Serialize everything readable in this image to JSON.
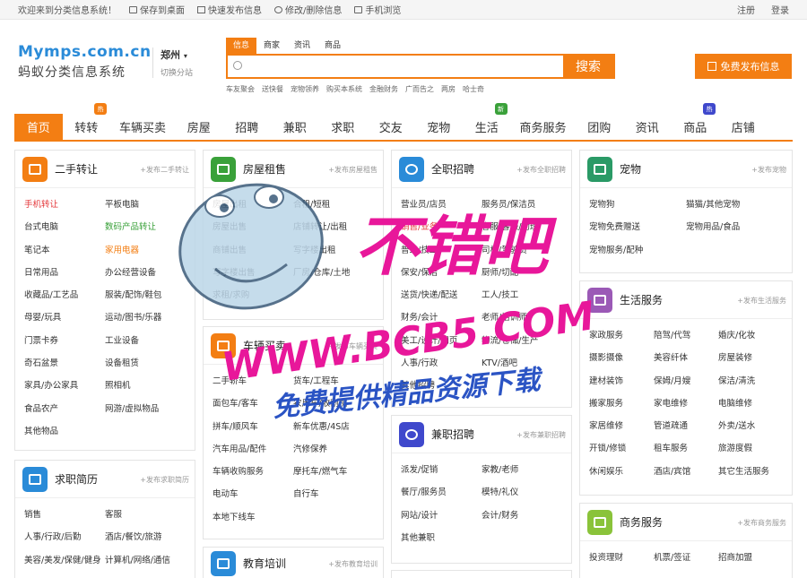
{
  "topbar": {
    "welcome": "欢迎来到分类信息系统！",
    "save_desktop": "保存到桌面",
    "quick_post": "快速发布信息",
    "edit_delete": "修改/删除信息",
    "mobile": "手机浏览",
    "register": "注册",
    "login": "登录"
  },
  "logo": {
    "en": "Mymps.com.cn",
    "cn": "蚂蚁分类信息系统"
  },
  "city": {
    "name": "郑州",
    "switch": "切换分站"
  },
  "search": {
    "tabs": [
      "信息",
      "商家",
      "资讯",
      "商品"
    ],
    "button": "搜索",
    "hot": [
      "车友聚会",
      "送快餐",
      "宠物领养",
      "购买本系统",
      "金融财务",
      "广而告之",
      "两房",
      "哈士奇"
    ]
  },
  "post_button": "免费发布信息",
  "nav": {
    "items": [
      "首页",
      "转转",
      "车辆买卖",
      "房屋",
      "招聘",
      "兼职",
      "求职",
      "交友",
      "宠物",
      "生活",
      "商务服务",
      "团购",
      "资讯",
      "商品",
      "店铺"
    ],
    "badges": {
      "zhuanzhuan": "热",
      "shenghuo": "新",
      "shangpin": "热"
    },
    "colors": {
      "accent": "#f37e13",
      "badge_orange": "#f37e13",
      "badge_green": "#3aa13a",
      "badge_blue": "#3f48cc"
    }
  },
  "panels": {
    "ershou": {
      "title": "二手转让",
      "add": "+发布二手转让",
      "icon": "cart-icon",
      "color": "#f37e13",
      "items": [
        "手机转让",
        "平板电脑",
        "台式电脑",
        "数码产品转让",
        "笔记本",
        "家用电器",
        "日常用品",
        "办公经营设备",
        "收藏品/工艺品",
        "服装/配饰/鞋包",
        "母婴/玩具",
        "运动/图书/乐器",
        "门票卡券",
        "工业设备",
        "奇石盆景",
        "设备租赁",
        "家具/办公家具",
        "照相机",
        "食品农产",
        "网游/虚拟物品",
        "其他物品"
      ]
    },
    "qiuzhi": {
      "title": "求职简历",
      "add": "+发布求职简历",
      "icon": "resume-icon",
      "color": "#2a8bd8",
      "items": [
        "销售",
        "客服",
        "人事/行政/后勤",
        "酒店/餐饮/旅游",
        "美容/美发/保健/健身",
        "计算机/网络/通信"
      ]
    },
    "fangwu": {
      "title": "房屋租售",
      "add": "+发布房屋租售",
      "icon": "house-icon",
      "color": "#3aa13a",
      "items": [
        "房屋出租",
        "合租/短租",
        "房屋出售",
        "店铺转让/出租",
        "商铺出售",
        "写字楼出租",
        "写字楼出售",
        "厂房/仓库/土地",
        "求租/求购"
      ]
    },
    "cheliang": {
      "title": "车辆买卖",
      "add": "+发布车辆买卖",
      "icon": "car-icon",
      "color": "#f37e13",
      "items": [
        "二手轿车",
        "货车/工程车",
        "面包车/客车",
        "农用车/收割机",
        "拼车/顺风车",
        "新车优惠/4S店",
        "汽车用品/配件",
        "汽修保养",
        "车辆收购服务",
        "摩托车/燃气车",
        "电动车",
        "自行车",
        "本地下线车"
      ]
    },
    "jiaoyu": {
      "title": "教育培训",
      "add": "+发布教育培训",
      "icon": "graduation-icon",
      "color": "#2a8bd8"
    },
    "quanzhi": {
      "title": "全职招聘",
      "add": "+发布全职招聘",
      "icon": "magnifier-icon",
      "color": "#2a8bd8",
      "items": [
        "营业员/店员",
        "服务员/保洁员",
        "销售/业务",
        "客服/客服/助理",
        "普工/技工",
        "司机/驾驶员",
        "保安/保洁",
        "厨师/切配",
        "送货/快递/配送",
        "工人/技工",
        "财务/会计",
        "老师/培训师",
        "美工/设计/网页",
        "物流/仓储/生产",
        "人事/行政",
        "KTV/酒吧",
        "其他招聘"
      ]
    },
    "jianzhi": {
      "title": "兼职招聘",
      "add": "+发布兼职招聘",
      "icon": "clock-icon",
      "color": "#3f48cc",
      "items": [
        "派发/促销",
        "家教/老师",
        "餐厅/服务员",
        "模特/礼仪",
        "网站/设计",
        "会计/财务",
        "其他兼职"
      ]
    },
    "chongwu": {
      "title": "宠物",
      "add": "+发布宠物",
      "icon": "dog-icon",
      "color": "#2a9a66",
      "items": [
        "宠物狗",
        "猫猫/其他宠物",
        "宠物免费赠送",
        "宠物用品/食品",
        "宠物服务/配种"
      ]
    },
    "shenghuo": {
      "title": "生活服务",
      "add": "+发布生活服务",
      "icon": "life-icon",
      "color": "#9b59b6",
      "items": [
        "家政服务",
        "陪驾/代驾",
        "婚庆/化妆",
        "摄影摄像",
        "美容纤体",
        "房屋装修",
        "建材装饰",
        "保姆/月嫂",
        "保洁/清洗",
        "搬家服务",
        "家电维修",
        "电脑维修",
        "家居维修",
        "管道疏通",
        "外卖/送水",
        "开锁/修锁",
        "租车服务",
        "旅游度假",
        "休闲娱乐",
        "酒店/宾馆",
        "其它生活服务"
      ]
    },
    "shangwu": {
      "title": "商务服务",
      "add": "+发布商务服务",
      "icon": "phone-icon",
      "color": "#8ac33a",
      "items": [
        "投资理财",
        "机票/签证",
        "招商加盟"
      ]
    }
  },
  "watermark": {
    "line1": "不错吧",
    "line2": "WWW.BCB5.COM",
    "line3": "免费提供精品资源下载",
    "color": "#e8179a"
  }
}
